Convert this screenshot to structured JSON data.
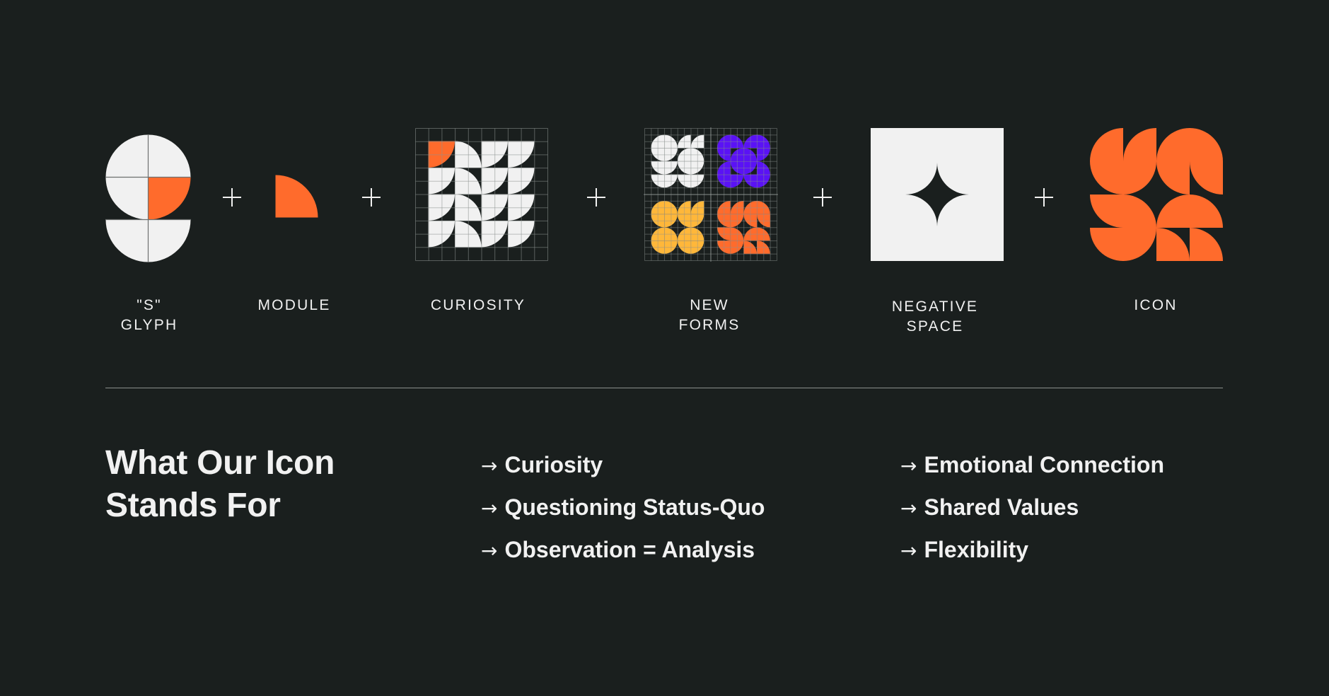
{
  "colors": {
    "background": "#1a1f1e",
    "light": "#f1f1f1",
    "orange": "#ff6b2c",
    "purple": "#5a12f5",
    "yellow": "#ffb73a",
    "grid": "#4a504e"
  },
  "steps": [
    {
      "id": "s-glyph",
      "label_lines": [
        "\"S\"",
        "GLYPH"
      ]
    },
    {
      "id": "module",
      "label_lines": [
        "MODULE"
      ]
    },
    {
      "id": "curiosity",
      "label_lines": [
        "CURIOSITY"
      ]
    },
    {
      "id": "new-forms",
      "label_lines": [
        "NEW",
        "FORMS"
      ]
    },
    {
      "id": "negative-space",
      "label_lines": [
        "NEGATIVE",
        "SPACE"
      ]
    },
    {
      "id": "icon",
      "label_lines": [
        "ICON"
      ]
    }
  ],
  "operator": "+",
  "tiles": {
    "s_glyph": [
      [
        "BR",
        "BL"
      ],
      [
        "TR",
        "TL*"
      ],
      [
        "TR",
        "TL"
      ]
    ],
    "curiosity": [
      [
        "TL*",
        "BL",
        "TL",
        "TL"
      ],
      [
        "TL",
        "BL",
        "TL",
        "TL"
      ],
      [
        "TL",
        "BL",
        "TL",
        "TL"
      ],
      [
        "TL",
        "BL",
        "TL",
        "TL"
      ]
    ],
    "new_forms": {
      "white": [
        [
          "BR",
          "BL",
          "BR",
          "BR"
        ],
        [
          "TR",
          "TL",
          "BR",
          "BL"
        ],
        [
          "TR",
          "TL",
          "TR",
          "TL"
        ],
        [
          "TR",
          "TL",
          "TR",
          "TL"
        ]
      ],
      "purple": [
        [
          "BR",
          "BL",
          "BR",
          "BL"
        ],
        [
          "TR",
          "BR",
          "BL",
          "TL"
        ],
        [
          "BR",
          "TR",
          "TL",
          "BL"
        ],
        [
          "TR",
          "TL",
          "TR",
          "TL"
        ]
      ],
      "yellow": [
        [
          "BR",
          "BL",
          "BR",
          "BR"
        ],
        [
          "TR",
          "TL",
          "TR",
          "TL"
        ],
        [
          "BR",
          "BL",
          "BR",
          "BL"
        ],
        [
          "TR",
          "TL",
          "TR",
          "TL"
        ]
      ],
      "orange": [
        [
          "BR",
          "BR",
          "BR",
          "BL"
        ],
        [
          "TR",
          "TL",
          "TR",
          "TR"
        ],
        [
          "TR",
          "BL",
          "BR",
          "BL"
        ],
        [
          "TR",
          "TL",
          "BL",
          "BL"
        ]
      ]
    },
    "icon": [
      [
        "BR",
        "BR",
        "BR",
        "BL"
      ],
      [
        "TR",
        "TL",
        "TR",
        "TR"
      ],
      [
        "TR",
        "BL",
        "BR",
        "BL"
      ],
      [
        "TR",
        "TL",
        "BL",
        "BL"
      ]
    ]
  },
  "values": {
    "heading_lines": [
      "What Our Icon",
      "Stands For"
    ],
    "arrow_glyph": "→",
    "column_1": [
      "Curiosity",
      "Questioning Status-Quo",
      "Observation = Analysis"
    ],
    "column_2": [
      "Emotional Connection",
      "Shared Values",
      "Flexibility"
    ]
  }
}
